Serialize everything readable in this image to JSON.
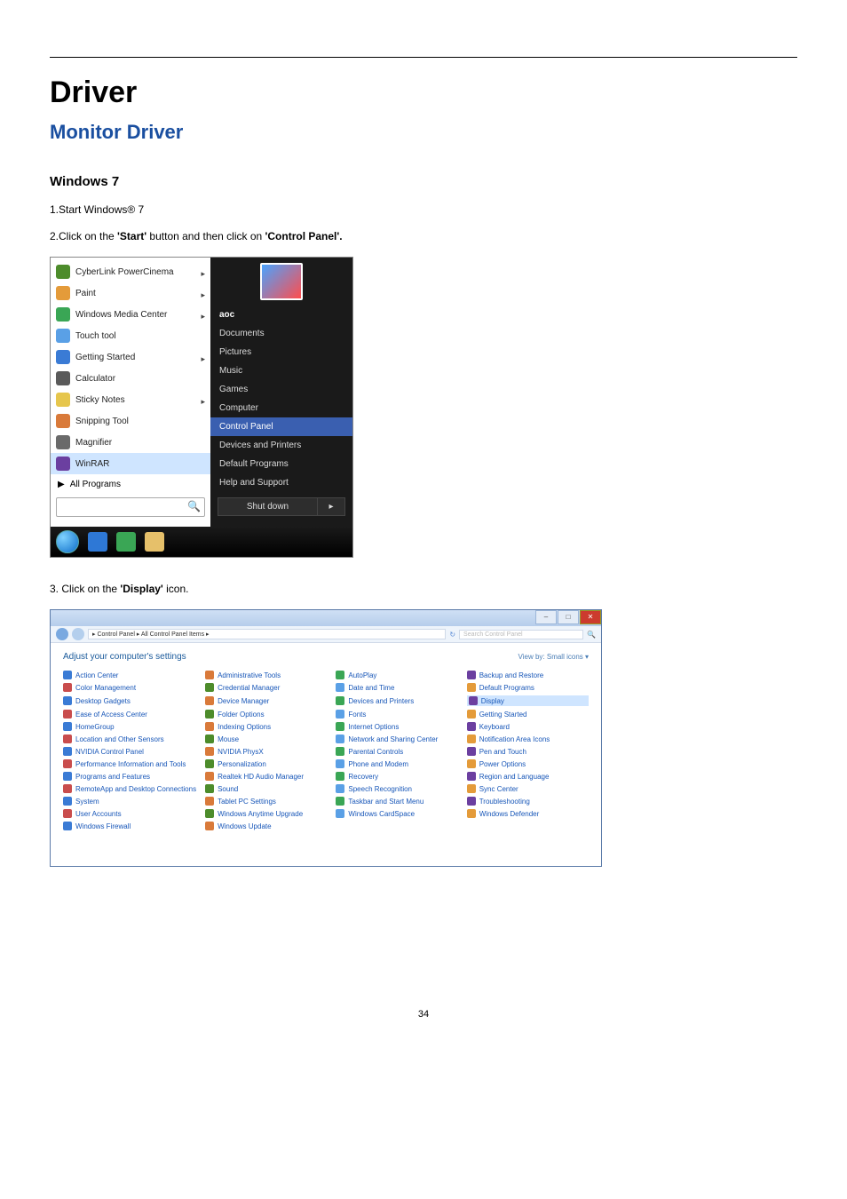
{
  "page_number": "34",
  "heading": "Driver",
  "subheading": "Monitor Driver",
  "section": "Windows 7",
  "steps": {
    "s1": "1.Start Windows® 7",
    "s2_pre": "2.Click on the ",
    "s2_b1": "'Start'",
    "s2_mid": " button and then click on ",
    "s2_b2": "'Control Panel'.",
    "s3_pre": "3. Click on the ",
    "s3_b1": "'Display'",
    "s3_post": " icon."
  },
  "start_menu": {
    "programs": [
      "CyberLink PowerCinema",
      "Paint",
      "Windows Media Center",
      "Touch tool",
      "Getting Started",
      "Calculator",
      "Sticky Notes",
      "Snipping Tool",
      "Magnifier",
      "WinRAR"
    ],
    "highlight_index": 9,
    "submenu_arrow_indices": [
      0,
      1,
      2,
      4,
      6
    ],
    "all_programs": "All Programs",
    "user": "aoc",
    "right_items": [
      "Documents",
      "Pictures",
      "Music",
      "Games",
      "Computer",
      "Control Panel",
      "Devices and Printers",
      "Default Programs",
      "Help and Support"
    ],
    "right_highlight_index": 5,
    "shutdown": "Shut down"
  },
  "control_panel": {
    "path": "▸ Control Panel ▸ All Control Panel Items ▸",
    "search_placeholder": "Search Control Panel",
    "title": "Adjust your computer's settings",
    "view_label": "View by:  Small icons ▾",
    "items_col1": [
      "Action Center",
      "Color Management",
      "Desktop Gadgets",
      "Ease of Access Center",
      "HomeGroup",
      "Location and Other Sensors",
      "NVIDIA Control Panel",
      "Performance Information and Tools",
      "Programs and Features",
      "RemoteApp and Desktop Connections",
      "System",
      "User Accounts",
      "Windows Firewall"
    ],
    "items_col2": [
      "Administrative Tools",
      "Credential Manager",
      "Device Manager",
      "Folder Options",
      "Indexing Options",
      "Mouse",
      "NVIDIA PhysX",
      "Personalization",
      "Realtek HD Audio Manager",
      "Sound",
      "Tablet PC Settings",
      "Windows Anytime Upgrade",
      "Windows Update"
    ],
    "items_col3": [
      "AutoPlay",
      "Date and Time",
      "Devices and Printers",
      "Fonts",
      "Internet Options",
      "Network and Sharing Center",
      "Parental Controls",
      "Phone and Modem",
      "Recovery",
      "Speech Recognition",
      "Taskbar and Start Menu",
      "Windows CardSpace"
    ],
    "items_col4": [
      "Backup and Restore",
      "Default Programs",
      "Display",
      "Getting Started",
      "Keyboard",
      "Notification Area Icons",
      "Pen and Touch",
      "Power Options",
      "Region and Language",
      "Sync Center",
      "Troubleshooting",
      "Windows Defender"
    ],
    "col4_highlight_index": 2
  }
}
